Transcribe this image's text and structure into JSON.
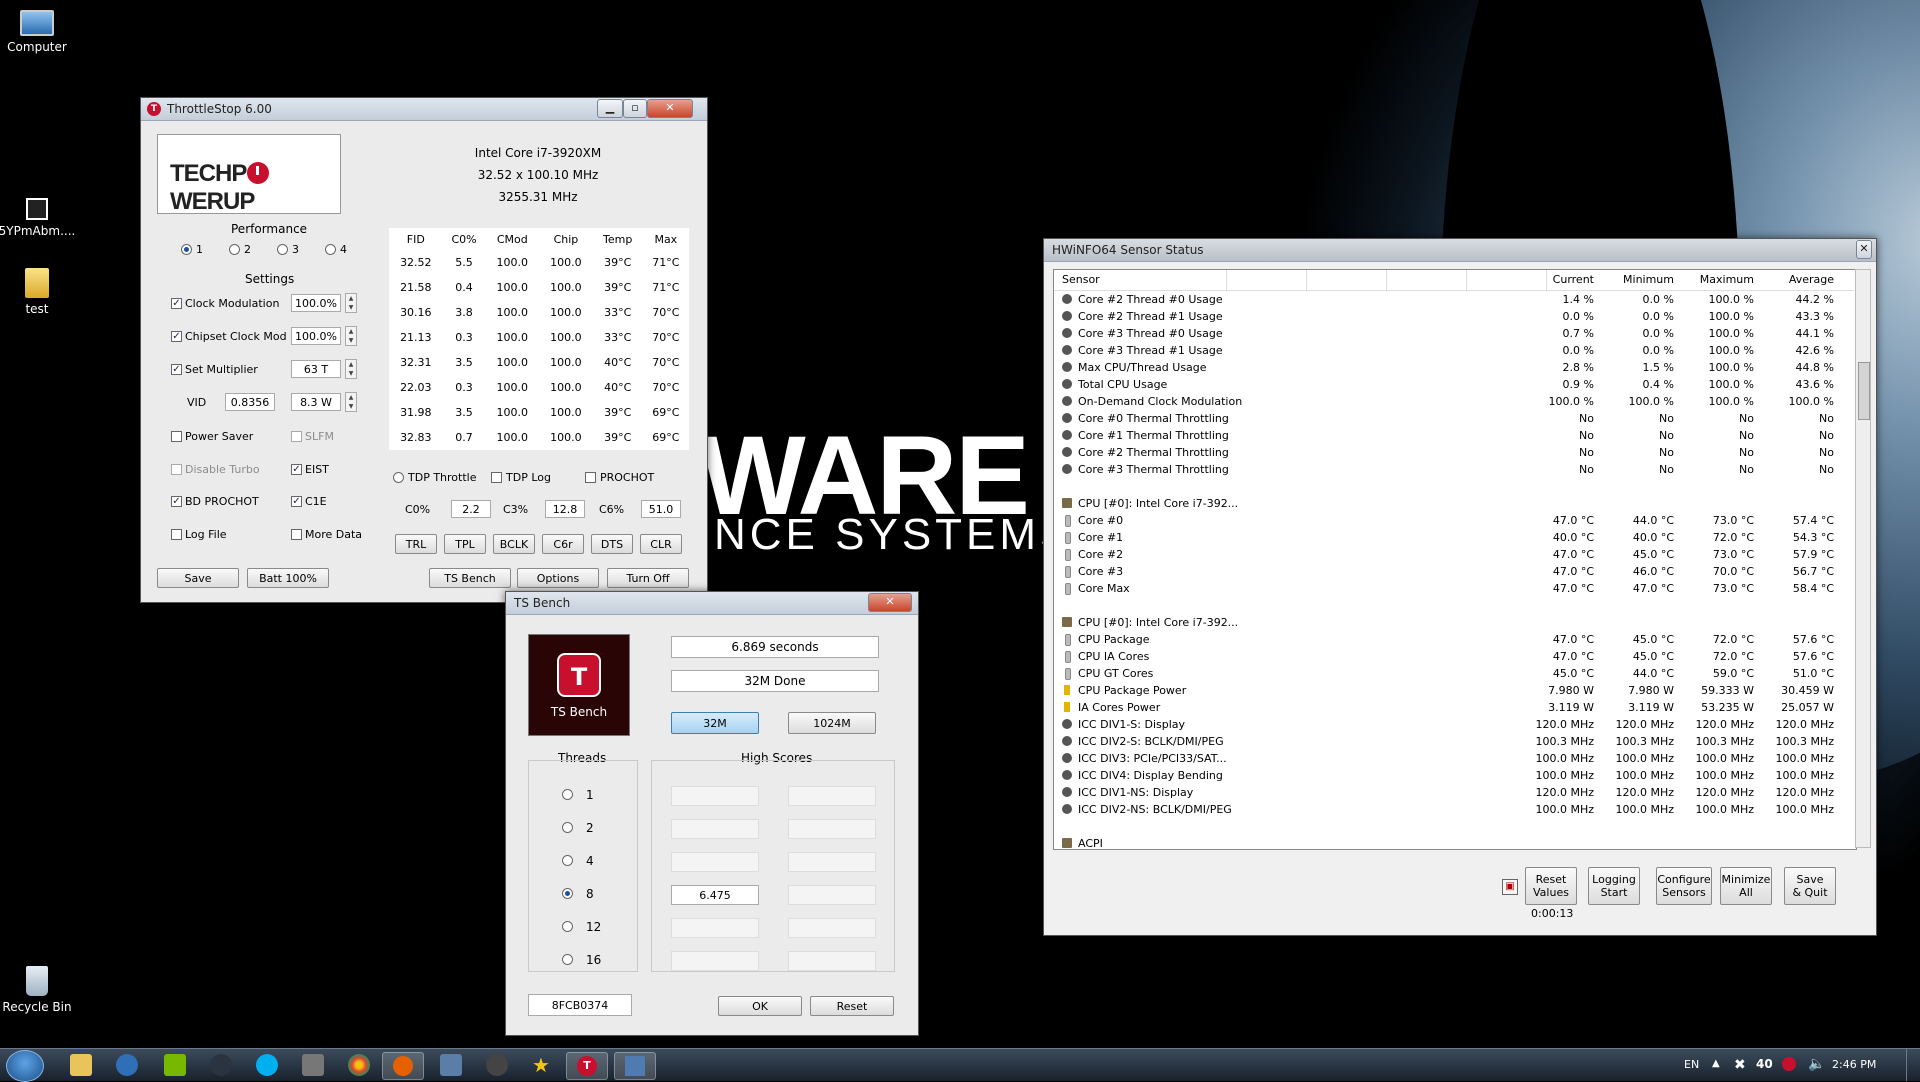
{
  "desktop": {
    "icons": [
      {
        "label": "Computer"
      },
      {
        "label": "5YPmAbm...."
      },
      {
        "label": "test"
      },
      {
        "label": "Recycle Bin"
      }
    ],
    "wallpaper_text": {
      "main": "WARE",
      "sub": "NCE SYSTEMS"
    }
  },
  "throttlestop": {
    "title": "ThrottleStop 6.00",
    "logo_pre": "TECHP",
    "logo_post": "WERUP",
    "cpu_name": "Intel Core i7-3920XM",
    "multiplier": "32.52 x 100.10 MHz",
    "frequency": "3255.31 MHz",
    "performance_label": "Performance",
    "profiles": [
      "1",
      "2",
      "3",
      "4"
    ],
    "settings_label": "Settings",
    "clock_mod": {
      "label": "Clock Modulation",
      "value": "100.0%"
    },
    "chipset_mod": {
      "label": "Chipset Clock Mod",
      "value": "100.0%"
    },
    "set_mult": {
      "label": "Set Multiplier",
      "value": "63 T"
    },
    "vid": {
      "label": "VID",
      "value": "0.8356",
      "power": "8.3 W"
    },
    "power_saver": "Power Saver",
    "slfm": "SLFM",
    "disable_turbo": "Disable Turbo",
    "eist": "EIST",
    "bd_prochot": "BD PROCHOT",
    "c1e": "C1E",
    "log_file": "Log File",
    "more_data": "More Data",
    "table_headers": [
      "FID",
      "C0%",
      "CMod",
      "Chip",
      "Temp",
      "Max"
    ],
    "table_rows": [
      [
        "32.52",
        "5.5",
        "100.0",
        "100.0",
        "39°C",
        "71°C"
      ],
      [
        "21.58",
        "0.4",
        "100.0",
        "100.0",
        "39°C",
        "71°C"
      ],
      [
        "30.16",
        "3.8",
        "100.0",
        "100.0",
        "33°C",
        "70°C"
      ],
      [
        "21.13",
        "0.3",
        "100.0",
        "100.0",
        "33°C",
        "70°C"
      ],
      [
        "32.31",
        "3.5",
        "100.0",
        "100.0",
        "40°C",
        "70°C"
      ],
      [
        "22.03",
        "0.3",
        "100.0",
        "100.0",
        "40°C",
        "70°C"
      ],
      [
        "31.98",
        "3.5",
        "100.0",
        "100.0",
        "39°C",
        "69°C"
      ],
      [
        "32.83",
        "0.7",
        "100.0",
        "100.0",
        "39°C",
        "69°C"
      ]
    ],
    "tdp_throttle": "TDP Throttle",
    "tdp_log": "TDP Log",
    "prochot": "PROCHOT",
    "c0_label": "C0%",
    "c0_value": "2.2",
    "c3_label": "C3%",
    "c3_value": "12.8",
    "c6_label": "C6%",
    "c6_value": "51.0",
    "tool_buttons": [
      "TRL",
      "TPL",
      "BCLK",
      "C6r",
      "DTS",
      "CLR"
    ],
    "save": "Save",
    "batt": "Batt 100%",
    "ts_bench": "TS Bench",
    "options": "Options",
    "turn_off": "Turn Off"
  },
  "tsbench": {
    "title": "TS Bench",
    "logo_letter": "T",
    "logo_caption": "TS Bench",
    "time": "6.869 seconds",
    "status": "32M Done",
    "size_32": "32M",
    "size_1024": "1024M",
    "threads_label": "Threads",
    "threads": [
      "1",
      "2",
      "4",
      "8",
      "12",
      "16"
    ],
    "high_scores_label": "High Scores",
    "score_8": "6.475",
    "code": "8FCB0374",
    "ok": "OK",
    "reset": "Reset"
  },
  "hwinfo": {
    "title": "HWiNFO64 Sensor Status",
    "columns": [
      "Sensor",
      "Current",
      "Minimum",
      "Maximum",
      "Average"
    ],
    "rows": [
      {
        "icon": "gauge",
        "name": "Core #2 Thread #0 Usage",
        "v": [
          "1.4 %",
          "0.0 %",
          "100.0 %",
          "44.2 %"
        ]
      },
      {
        "icon": "gauge",
        "name": "Core #2 Thread #1 Usage",
        "v": [
          "0.0 %",
          "0.0 %",
          "100.0 %",
          "43.3 %"
        ]
      },
      {
        "icon": "gauge",
        "name": "Core #3 Thread #0 Usage",
        "v": [
          "0.7 %",
          "0.0 %",
          "100.0 %",
          "44.1 %"
        ]
      },
      {
        "icon": "gauge",
        "name": "Core #3 Thread #1 Usage",
        "v": [
          "0.0 %",
          "0.0 %",
          "100.0 %",
          "42.6 %"
        ]
      },
      {
        "icon": "gauge",
        "name": "Max CPU/Thread Usage",
        "v": [
          "2.8 %",
          "1.5 %",
          "100.0 %",
          "44.8 %"
        ]
      },
      {
        "icon": "gauge",
        "name": "Total CPU Usage",
        "v": [
          "0.9 %",
          "0.4 %",
          "100.0 %",
          "43.6 %"
        ]
      },
      {
        "icon": "gauge",
        "name": "On-Demand Clock Modulation",
        "v": [
          "100.0 %",
          "100.0 %",
          "100.0 %",
          "100.0 %"
        ]
      },
      {
        "icon": "gauge",
        "name": "Core #0 Thermal Throttling",
        "v": [
          "No",
          "No",
          "No",
          "No"
        ]
      },
      {
        "icon": "gauge",
        "name": "Core #1 Thermal Throttling",
        "v": [
          "No",
          "No",
          "No",
          "No"
        ]
      },
      {
        "icon": "gauge",
        "name": "Core #2 Thermal Throttling",
        "v": [
          "No",
          "No",
          "No",
          "No"
        ]
      },
      {
        "icon": "gauge",
        "name": "Core #3 Thermal Throttling",
        "v": [
          "No",
          "No",
          "No",
          "No"
        ]
      },
      {
        "icon": "none",
        "name": "",
        "v": [
          "",
          "",
          "",
          ""
        ]
      },
      {
        "icon": "cpu",
        "name": "CPU [#0]: Intel Core i7-392...",
        "v": [
          "",
          "",
          "",
          ""
        ]
      },
      {
        "icon": "therm",
        "name": "Core #0",
        "v": [
          "47.0 °C",
          "44.0 °C",
          "73.0 °C",
          "57.4 °C"
        ]
      },
      {
        "icon": "therm",
        "name": "Core #1",
        "v": [
          "40.0 °C",
          "40.0 °C",
          "72.0 °C",
          "54.3 °C"
        ]
      },
      {
        "icon": "therm",
        "name": "Core #2",
        "v": [
          "47.0 °C",
          "45.0 °C",
          "73.0 °C",
          "57.9 °C"
        ]
      },
      {
        "icon": "therm",
        "name": "Core #3",
        "v": [
          "47.0 °C",
          "46.0 °C",
          "70.0 °C",
          "56.7 °C"
        ]
      },
      {
        "icon": "therm",
        "name": "Core Max",
        "v": [
          "47.0 °C",
          "47.0 °C",
          "73.0 °C",
          "58.4 °C"
        ]
      },
      {
        "icon": "none",
        "name": "",
        "v": [
          "",
          "",
          "",
          ""
        ]
      },
      {
        "icon": "cpu",
        "name": "CPU [#0]: Intel Core i7-392...",
        "v": [
          "",
          "",
          "",
          ""
        ]
      },
      {
        "icon": "therm",
        "name": "CPU Package",
        "v": [
          "47.0 °C",
          "45.0 °C",
          "72.0 °C",
          "57.6 °C"
        ]
      },
      {
        "icon": "therm",
        "name": "CPU IA Cores",
        "v": [
          "47.0 °C",
          "45.0 °C",
          "72.0 °C",
          "57.6 °C"
        ]
      },
      {
        "icon": "therm",
        "name": "CPU GT Cores",
        "v": [
          "45.0 °C",
          "44.0 °C",
          "59.0 °C",
          "51.0 °C"
        ]
      },
      {
        "icon": "bolt",
        "name": "CPU Package Power",
        "v": [
          "7.980 W",
          "7.980 W",
          "59.333 W",
          "30.459 W"
        ]
      },
      {
        "icon": "bolt",
        "name": "IA Cores Power",
        "v": [
          "3.119 W",
          "3.119 W",
          "53.235 W",
          "25.057 W"
        ]
      },
      {
        "icon": "gauge",
        "name": "ICC DIV1-S: Display",
        "v": [
          "120.0 MHz",
          "120.0 MHz",
          "120.0 MHz",
          "120.0 MHz"
        ]
      },
      {
        "icon": "gauge",
        "name": "ICC DIV2-S: BCLK/DMI/PEG",
        "v": [
          "100.3 MHz",
          "100.3 MHz",
          "100.3 MHz",
          "100.3 MHz"
        ]
      },
      {
        "icon": "gauge",
        "name": "ICC DIV3: PCIe/PCI33/SAT...",
        "v": [
          "100.0 MHz",
          "100.0 MHz",
          "100.0 MHz",
          "100.0 MHz"
        ]
      },
      {
        "icon": "gauge",
        "name": "ICC DIV4: Display Bending",
        "v": [
          "100.0 MHz",
          "100.0 MHz",
          "100.0 MHz",
          "100.0 MHz"
        ]
      },
      {
        "icon": "gauge",
        "name": "ICC DIV1-NS: Display",
        "v": [
          "120.0 MHz",
          "120.0 MHz",
          "120.0 MHz",
          "120.0 MHz"
        ]
      },
      {
        "icon": "gauge",
        "name": "ICC DIV2-NS: BCLK/DMI/PEG",
        "v": [
          "100.0 MHz",
          "100.0 MHz",
          "100.0 MHz",
          "100.0 MHz"
        ]
      },
      {
        "icon": "none",
        "name": "",
        "v": [
          "",
          "",
          "",
          ""
        ]
      },
      {
        "icon": "cpu",
        "name": "ACPI",
        "v": [
          "",
          "",
          "",
          ""
        ]
      }
    ],
    "buttons": [
      "Reset\nValues",
      "Logging\nStart",
      "Configure\nSensors",
      "Minimize\nAll",
      "Save\n& Quit"
    ],
    "timer": "0:00:13"
  },
  "taskbar": {
    "lang": "EN",
    "tray_number": "40",
    "clock": "2:46 PM"
  },
  "colors": {
    "accent": "#c8102e",
    "selected_button": "#bcdcf4"
  }
}
